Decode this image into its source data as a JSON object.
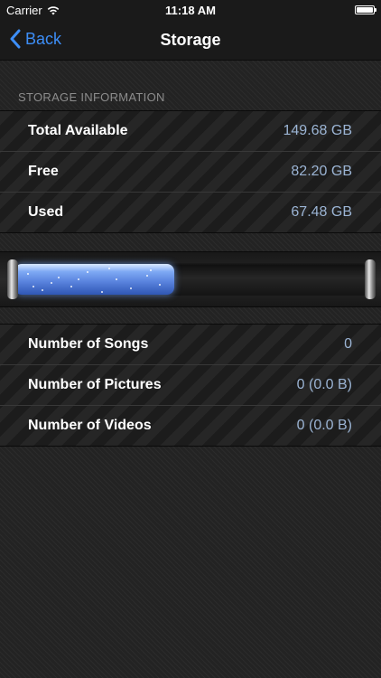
{
  "status_bar": {
    "carrier": "Carrier",
    "time": "11:18 AM",
    "wifi_icon": "wifi-icon",
    "battery_icon": "battery-icon"
  },
  "nav": {
    "back_label": "Back",
    "back_icon": "chevron-left-icon",
    "title": "Storage",
    "accent_color": "#3d8ef7"
  },
  "storage": {
    "header": "STORAGE INFORMATION",
    "rows": [
      {
        "label": "Total Available",
        "value": "149.68 GB"
      },
      {
        "label": "Free",
        "value": "82.20 GB"
      },
      {
        "label": "Used",
        "value": "67.48 GB"
      }
    ]
  },
  "gauge": {
    "used_fraction": 0.4508,
    "fill_color": "#5c86e0"
  },
  "media": {
    "rows": [
      {
        "label": "Number of Songs",
        "value": "0"
      },
      {
        "label": "Number of Pictures",
        "value": "0 (0.0 B)"
      },
      {
        "label": "Number of Videos",
        "value": "0 (0.0 B)"
      }
    ]
  }
}
